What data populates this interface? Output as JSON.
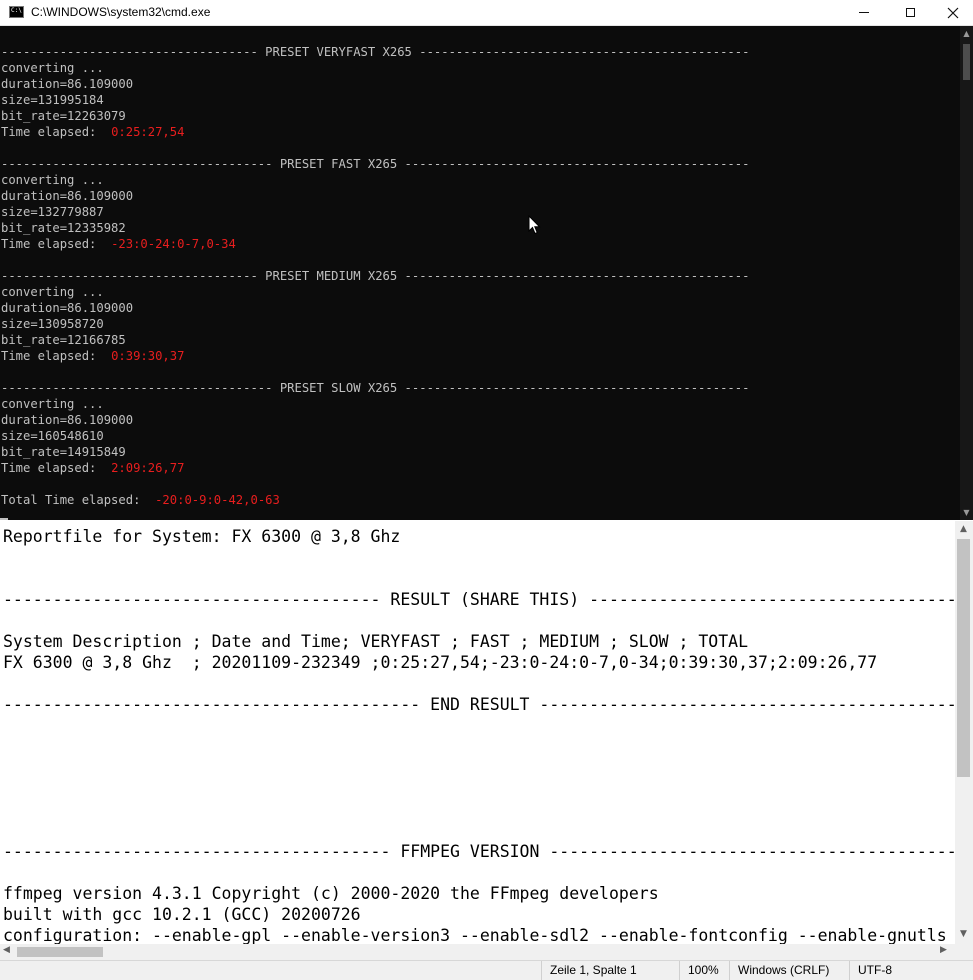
{
  "cmd_window": {
    "title": "C:\\WINDOWS\\system32\\cmd.exe",
    "lines": [
      {
        "text": "----------------------------------- PRESET VERYFAST X265 ---------------------------------------------"
      },
      {
        "text": "converting ..."
      },
      {
        "text": "duration=86.109000"
      },
      {
        "text": "size=131995184"
      },
      {
        "text": "bit_rate=12263079"
      },
      {
        "text": "Time elapsed:  ",
        "red": "0:25:27,54"
      },
      {
        "text": ""
      },
      {
        "text": "------------------------------------- PRESET FAST X265 -----------------------------------------------"
      },
      {
        "text": "converting ..."
      },
      {
        "text": "duration=86.109000"
      },
      {
        "text": "size=132779887"
      },
      {
        "text": "bit_rate=12335982"
      },
      {
        "text": "Time elapsed:  ",
        "red": "-23:0-24:0-7,0-34"
      },
      {
        "text": ""
      },
      {
        "text": "----------------------------------- PRESET MEDIUM X265 -----------------------------------------------"
      },
      {
        "text": "converting ..."
      },
      {
        "text": "duration=86.109000"
      },
      {
        "text": "size=130958720"
      },
      {
        "text": "bit_rate=12166785"
      },
      {
        "text": "Time elapsed:  ",
        "red": "0:39:30,37"
      },
      {
        "text": ""
      },
      {
        "text": "------------------------------------- PRESET SLOW X265 -----------------------------------------------"
      },
      {
        "text": "converting ..."
      },
      {
        "text": "duration=86.109000"
      },
      {
        "text": "size=160548610"
      },
      {
        "text": "bit_rate=14915849"
      },
      {
        "text": "Time elapsed:  ",
        "red": "2:09:26,77"
      },
      {
        "text": ""
      },
      {
        "text": "Total Time elapsed:  ",
        "red": "-20:0-9:0-42,0-63"
      }
    ]
  },
  "notepad": {
    "lines": [
      "Reportfile for System: FX 6300 @ 3,8 Ghz",
      "",
      "",
      "-------------------------------------- RESULT (SHARE THIS) -------------------------------------",
      "",
      "System Description ; Date and Time; VERYFAST ; FAST ; MEDIUM ; SLOW ; TOTAL",
      "FX 6300 @ 3,8 Ghz  ; 20201109-232349 ;0:25:27,54;-23:0-24:0-7,0-34;0:39:30,37;2:09:26,77",
      "",
      "------------------------------------------ END RESULT ------------------------------------------",
      "",
      "",
      "",
      "",
      "",
      "",
      "--------------------------------------- FFMPEG VERSION -----------------------------------------",
      "",
      "ffmpeg version 4.3.1 Copyright (c) 2000-2020 the FFmpeg developers",
      "built with gcc 10.2.1 (GCC) 20200726",
      "configuration: --enable-gpl --enable-version3 --enable-sdl2 --enable-fontconfig --enable-gnutls"
    ],
    "status": {
      "position": "Zeile 1, Spalte 1",
      "zoom": "100%",
      "line_ending": "Windows (CRLF)",
      "encoding": "UTF-8"
    }
  }
}
